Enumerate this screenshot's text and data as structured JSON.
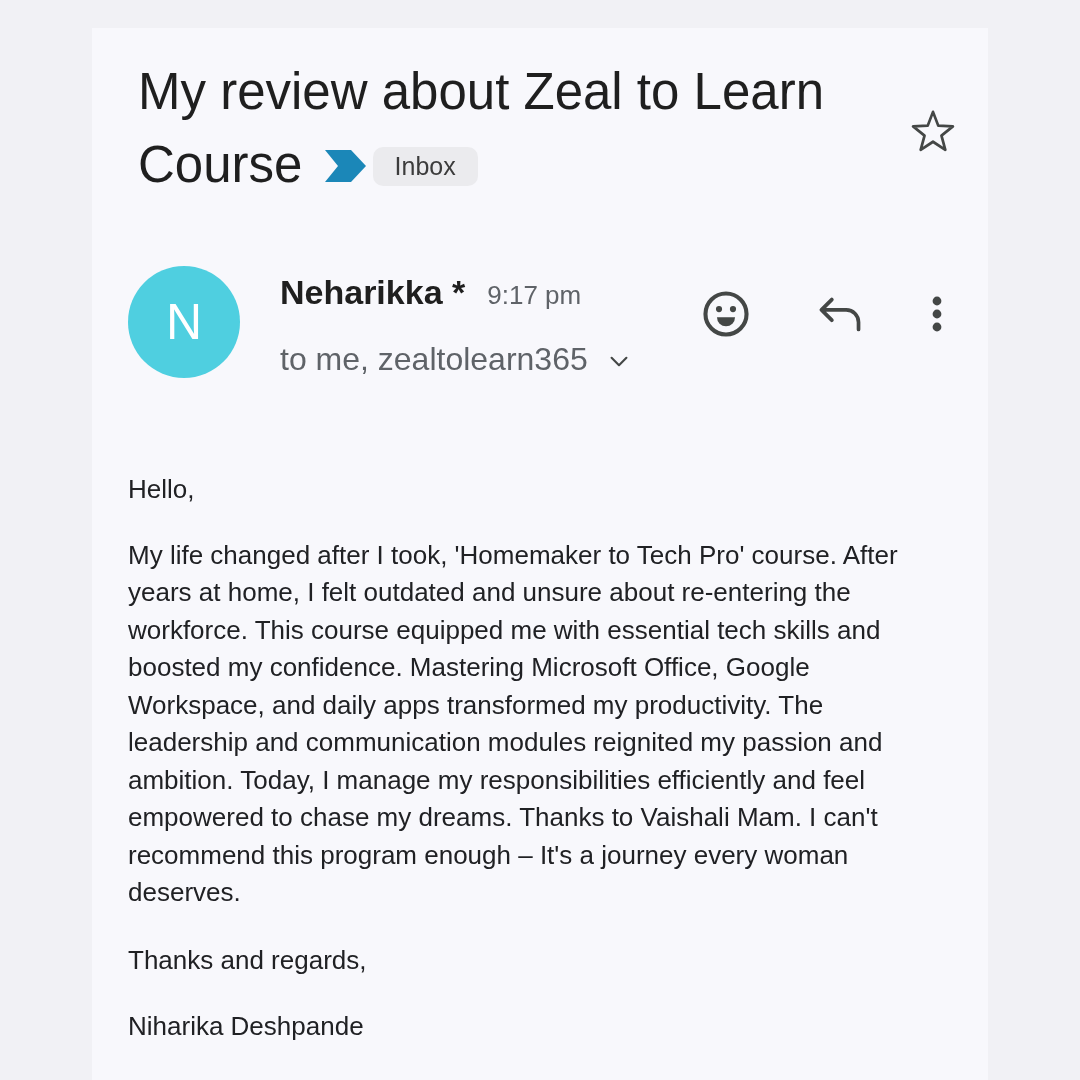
{
  "subject": {
    "title": "My review about Zeal to Learn Course",
    "important": true,
    "label": "Inbox",
    "starred": false
  },
  "sender": {
    "initial": "N",
    "name": "Neharikka *",
    "time": "9:17 pm",
    "recipients": "to me, zealtolearn365"
  },
  "body": {
    "greeting": "Hello,",
    "paragraphs": [
      "My life changed after I took, 'Homemaker to Tech Pro' course. After years at home, I felt outdated and unsure about re-entering the workforce. This course equipped me with essential tech skills and boosted my confidence. Mastering Microsoft Office, Google Workspace, and daily apps transformed my productivity. The leadership and communication modules reignited my passion and ambition. Today, I manage my responsibilities efficiently and feel empowered to chase my dreams. Thanks to Vaishali Mam. I can't recommend this program enough – It's a journey every woman deserves."
    ],
    "closing": "Thanks and regards,",
    "signature": "Niharika Deshpande"
  }
}
